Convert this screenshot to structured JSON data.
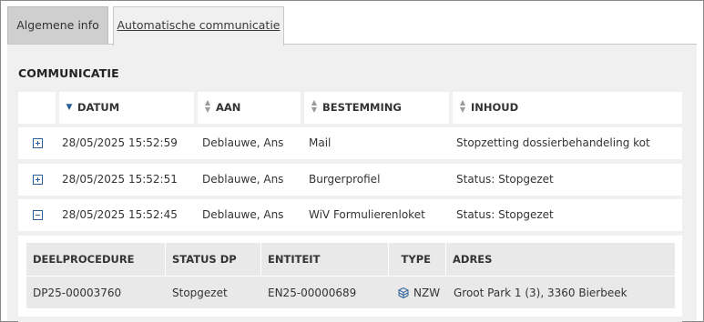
{
  "tabs": [
    {
      "label": "Algemene info",
      "active": false
    },
    {
      "label": "Automatische communicatie",
      "active": true
    }
  ],
  "section": {
    "title": "COMMUNICATIE"
  },
  "table": {
    "columns": [
      {
        "label": "DATUM",
        "sort": "desc"
      },
      {
        "label": "AAN",
        "sort": "none"
      },
      {
        "label": "BESTEMMING",
        "sort": "none"
      },
      {
        "label": "INHOUD",
        "sort": "none"
      }
    ],
    "rows": [
      {
        "expanded": false,
        "datum": "28/05/2025 15:52:59",
        "aan": "Deblauwe, Ans",
        "bestemming": "Mail",
        "inhoud": "Stopzetting dossierbehandeling kot"
      },
      {
        "expanded": false,
        "datum": "28/05/2025 15:52:51",
        "aan": "Deblauwe, Ans",
        "bestemming": "Burgerprofiel",
        "inhoud": "Status: Stopgezet"
      },
      {
        "expanded": true,
        "datum": "28/05/2025 15:52:45",
        "aan": "Deblauwe, Ans",
        "bestemming": "WiV Formulierenloket",
        "inhoud": "Status: Stopgezet"
      }
    ]
  },
  "detail": {
    "columns": [
      "DEELPROCEDURE",
      "STATUS DP",
      "ENTITEIT",
      "TYPE",
      "ADRES"
    ],
    "rows": [
      {
        "deelprocedure": "DP25-00003760",
        "status": "Stopgezet",
        "entiteit": "EN25-00000689",
        "type": "NZW",
        "type_icon": "building-icon",
        "adres": "Groot Park 1 (3), 3360 Bierbeek"
      }
    ]
  },
  "colors": {
    "link": "#2d5f99",
    "panel_bg": "#f0f0f0",
    "tab_inactive_bg": "#cfcfcf",
    "detail_bg": "#e9e9e9"
  }
}
